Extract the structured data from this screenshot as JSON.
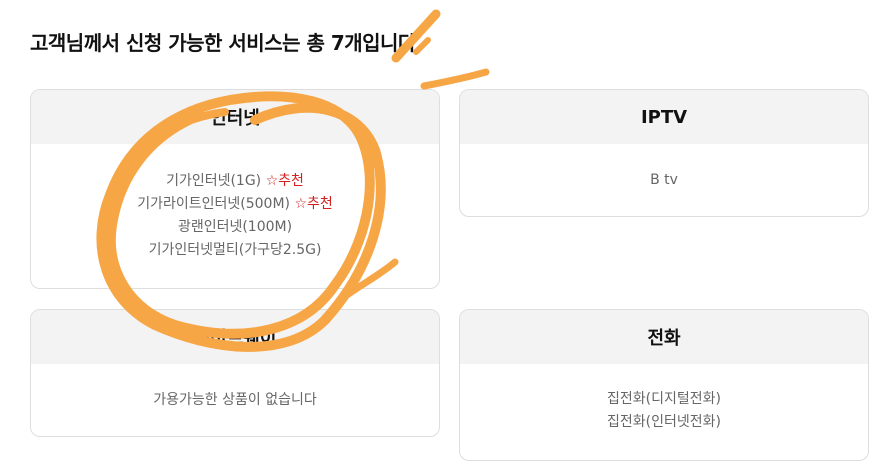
{
  "headline": "고객님께서 신청 가능한 서비스는 총 7개입니다.",
  "annotation_color": "#f7a646",
  "recommend_color": "#d32020",
  "cards": [
    {
      "title": "인터넷",
      "items": [
        {
          "label": "기가인터넷(1G)",
          "badge": "☆추천"
        },
        {
          "label": "기가라이트인터넷(500M)",
          "badge": "☆추천"
        },
        {
          "label": "광랜인터넷(100M)",
          "badge": ""
        },
        {
          "label": "기가인터넷멀티(가구당2.5G)",
          "badge": ""
        }
      ]
    },
    {
      "title": "IPTV",
      "items": [
        {
          "label": "B tv",
          "badge": ""
        }
      ]
    },
    {
      "title": "게이트웨이",
      "items": [
        {
          "label": "가용가능한 상품이 없습니다",
          "badge": ""
        }
      ]
    },
    {
      "title": "전화",
      "items": [
        {
          "label": "집전화(디지털전화)",
          "badge": ""
        },
        {
          "label": "집전화(인터넷전화)",
          "badge": ""
        }
      ]
    }
  ]
}
